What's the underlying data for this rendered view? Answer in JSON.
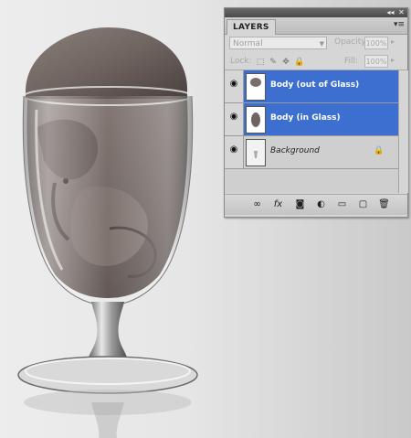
{
  "panel": {
    "tab_label": "LAYERS",
    "title_buttons": [
      "◂◂",
      "✕"
    ],
    "menu_icon": "panel-menu-icon",
    "blend_mode": "Normal",
    "opacity_label": "Opacity:",
    "opacity_value": "100%",
    "lock_label": "Lock:",
    "fill_label": "Fill:",
    "fill_value": "100%",
    "layers": [
      {
        "name": "Body (out of Glass)",
        "visible": true,
        "selected": true
      },
      {
        "name": "Body (in Glass)",
        "visible": true,
        "selected": true
      },
      {
        "name": "Background",
        "visible": true,
        "selected": false,
        "locked": true
      }
    ],
    "bottom_icons": [
      "link-layers-icon",
      "fx-icon",
      "layer-mask-icon",
      "adjustment-layer-icon",
      "group-folder-icon",
      "new-layer-icon",
      "trash-icon"
    ]
  },
  "colors": {
    "selection": "#3d6fd0",
    "panel_bg": "#d6d6d6"
  }
}
